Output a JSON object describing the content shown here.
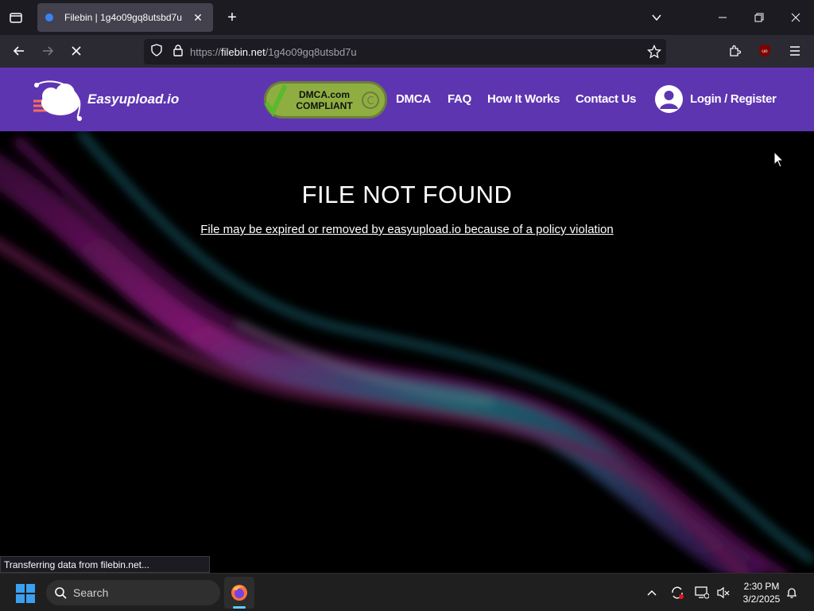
{
  "browser": {
    "tab_title": "Filebin | 1g4o09gq8utsbd7u",
    "url_prefix": "https://",
    "url_host": "filebin.net",
    "url_path": "/1g4o09gq8utsbd7u",
    "status_text": "Transferring data from filebin.net..."
  },
  "site": {
    "logo_text": "Easyupload.io",
    "dmca_badge": "DMCA.com COMPLIANT",
    "nav": [
      "DMCA",
      "FAQ",
      "How It Works",
      "Contact Us"
    ],
    "login_label": "Login / Register",
    "colors": {
      "header": "#5e35b1",
      "background": "#000000"
    }
  },
  "main": {
    "title": "FILE NOT FOUND",
    "subtitle": "File may be expired or removed by easyupload.io because of a policy violation"
  },
  "taskbar": {
    "search_label": "Search",
    "time": "2:30 PM",
    "date": "3/2/2025"
  }
}
